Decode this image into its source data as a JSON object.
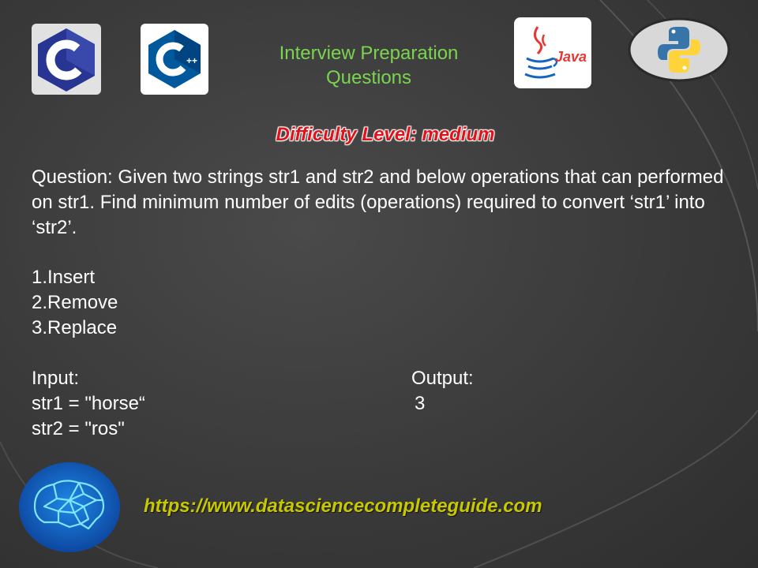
{
  "header": {
    "title_line1": "Interview Preparation",
    "title_line2": "Questions"
  },
  "logos": {
    "c": {
      "icon": "c-language-logo-icon",
      "letter": "C"
    },
    "cpp": {
      "icon": "cpp-language-logo-icon",
      "letter": "C",
      "suffix": "++"
    },
    "java": {
      "icon": "java-logo-icon",
      "text": "Java"
    },
    "python": {
      "icon": "python-logo-icon"
    },
    "brain": {
      "icon": "brain-network-logo-icon"
    }
  },
  "difficulty": "Difficulty Level: medium",
  "question": "Question: Given two strings str1 and str2 and below operations that can performed on str1. Find minimum number of edits (operations) required to convert ‘str1’ into ‘str2’.",
  "operations": [
    "1.Insert",
    "2.Remove",
    "3.Replace"
  ],
  "example": {
    "input_label": "Input:",
    "str1_line": "str1 = \"horse“",
    "str2_line": "str2 = \"ros\"",
    "output_label": "Output:",
    "output_value": "3"
  },
  "website": "https://www.datasciencecompleteguide.com",
  "colors": {
    "title_green": "#7bd44f",
    "difficulty_red": "#e0121a",
    "website_yellow": "#c8c800",
    "background": "#3b3b3b"
  }
}
